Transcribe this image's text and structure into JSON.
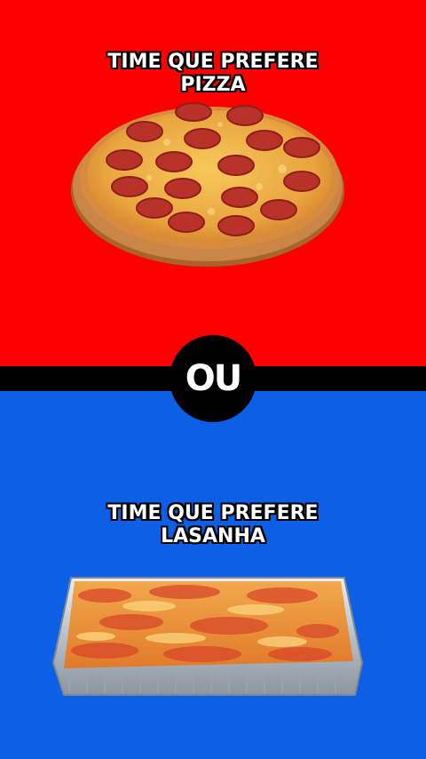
{
  "top": {
    "caption_line1": "TIME QUE PREFERE",
    "caption_line2": "PIZZA",
    "background": "#fe0000",
    "image": "pepperoni-pizza"
  },
  "divider": {
    "label": "OU",
    "color": "#000000"
  },
  "bottom": {
    "caption_line1": "TIME QUE PREFERE",
    "caption_line2": "LASANHA",
    "background": "#0d5fe6",
    "image": "lasagna-tray"
  }
}
